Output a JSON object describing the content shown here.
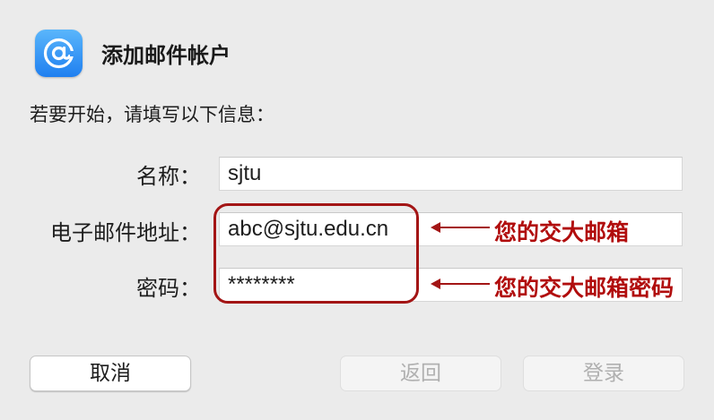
{
  "dialog": {
    "title": "添加邮件帐户",
    "intro": "若要开始，请填写以下信息："
  },
  "form": {
    "name_label": "名称：",
    "name_value": "sjtu",
    "email_label": "电子邮件地址：",
    "email_value": "abc@sjtu.edu.cn",
    "password_label": "密码：",
    "password_value": "********"
  },
  "annotations": {
    "email_note": "您的交大邮箱",
    "password_note": "您的交大邮箱密码",
    "color": "#b10d0d"
  },
  "buttons": {
    "cancel": "取消",
    "back": "返回",
    "login": "登录"
  },
  "icons": {
    "app": "at-sign-icon",
    "arrows": "arrow-left-icon"
  }
}
